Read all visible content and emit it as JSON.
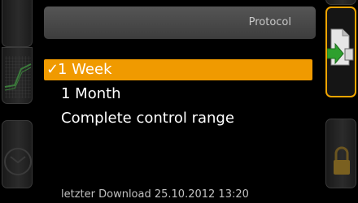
{
  "header": {
    "title": "Protocol"
  },
  "menu": {
    "items": [
      {
        "label": "1 Week",
        "selected": true
      },
      {
        "label": "1 Month",
        "selected": false
      },
      {
        "label": "Complete control range",
        "selected": false
      }
    ]
  },
  "footer": {
    "text": "letzter Download 25.10.2012   13:20"
  },
  "icons": {
    "left_top": "blank-button",
    "left_chart": "chart-icon",
    "left_clock": "clock-icon",
    "right_active": "document-export-icon",
    "right_lock": "lock-icon"
  },
  "colors": {
    "accent": "#f09a00",
    "background": "#000000"
  }
}
